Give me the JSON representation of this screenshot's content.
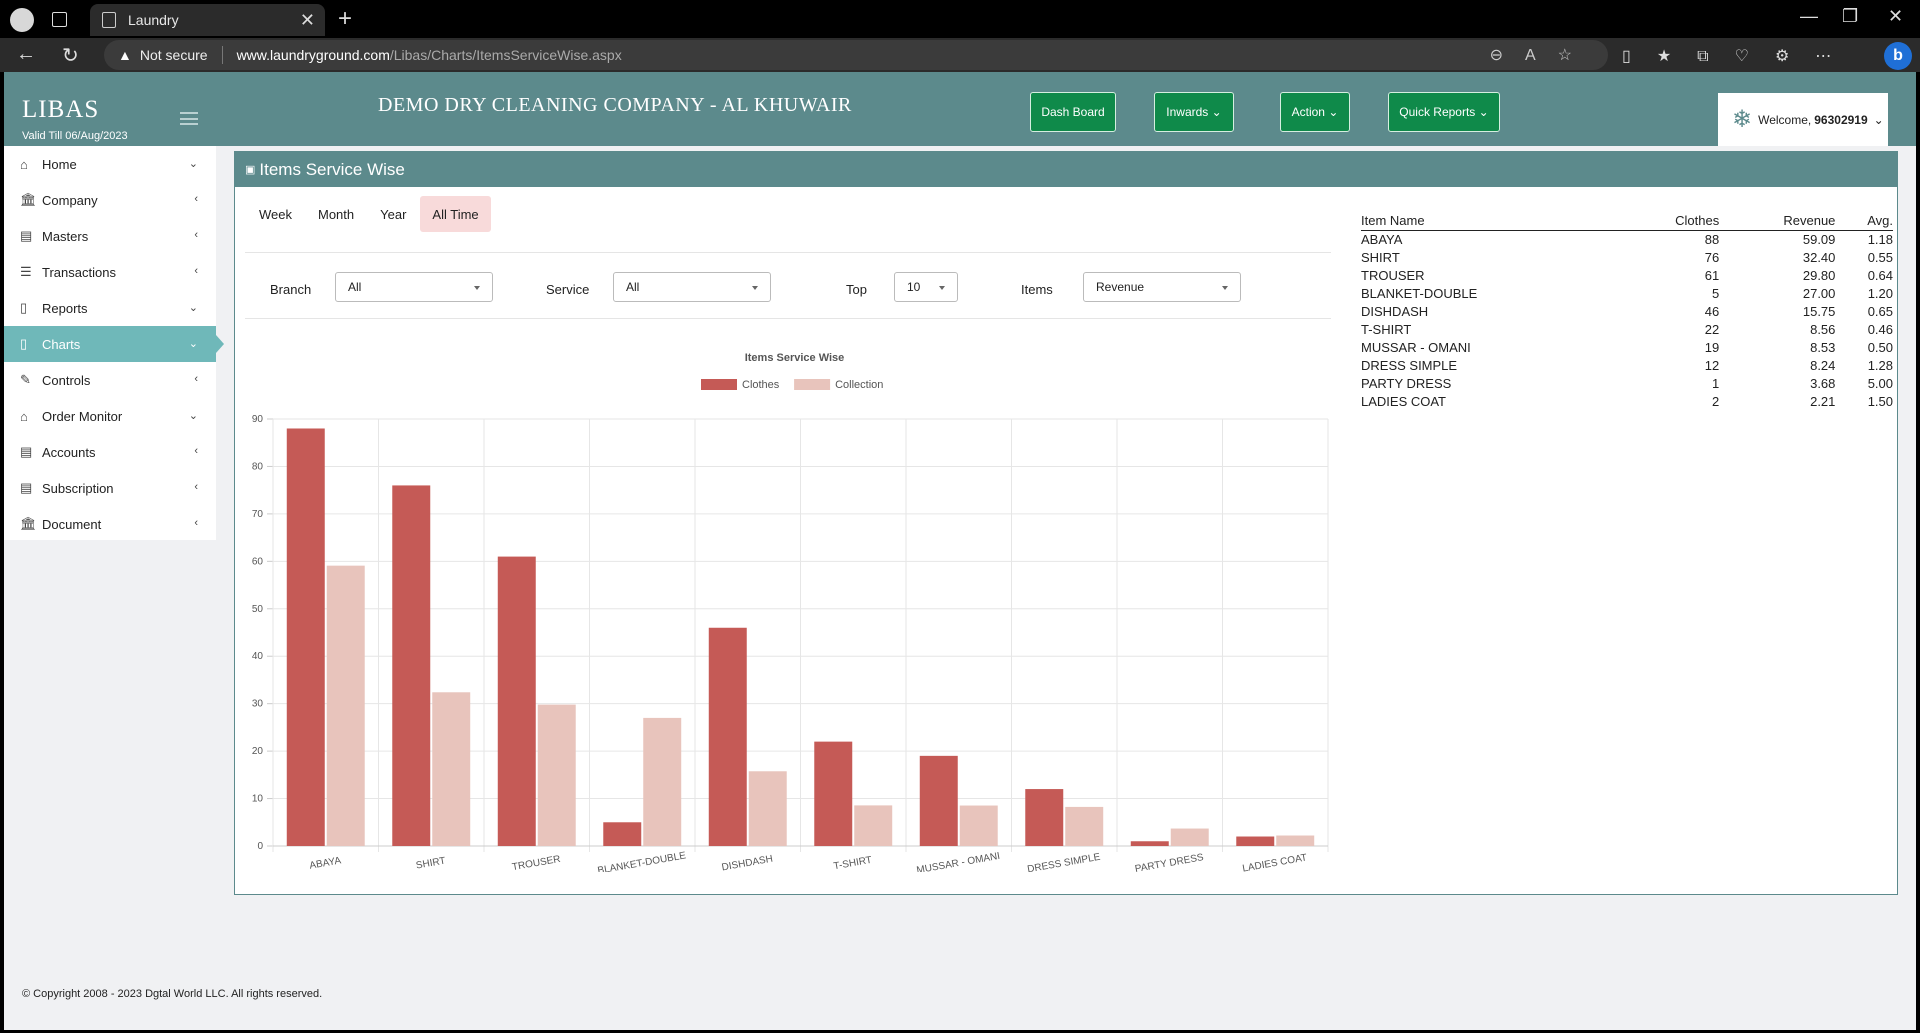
{
  "browser": {
    "tab_title": "Laundry",
    "not_secure": "Not secure",
    "url_host": "www.laundryground.com",
    "url_path": "/Libas/Charts/ItemsServiceWise.aspx"
  },
  "app": {
    "brand": "LIBAS",
    "valid_till": "Valid Till 06/Aug/2023",
    "company": "DEMO DRY CLEANING COMPANY - AL KHUWAIR",
    "buttons": {
      "dashboard": "Dash Board",
      "inwards": "Inwards",
      "action": "Action",
      "quick_reports": "Quick Reports"
    },
    "welcome_label": "Welcome,",
    "welcome_user": "96302919"
  },
  "sidebar": {
    "items": [
      {
        "label": "Home",
        "icon": "home-icon",
        "chevron": "down"
      },
      {
        "label": "Company",
        "icon": "bank-icon",
        "chevron": "left"
      },
      {
        "label": "Masters",
        "icon": "book-icon",
        "chevron": "left"
      },
      {
        "label": "Transactions",
        "icon": "list-icon",
        "chevron": "left"
      },
      {
        "label": "Reports",
        "icon": "file-icon",
        "chevron": "down"
      },
      {
        "label": "Charts",
        "icon": "file-icon",
        "chevron": "down",
        "active": true
      },
      {
        "label": "Controls",
        "icon": "wrench-icon",
        "chevron": "left"
      },
      {
        "label": "Order Monitor",
        "icon": "home-icon",
        "chevron": "down"
      },
      {
        "label": "Accounts",
        "icon": "book-icon",
        "chevron": "left"
      },
      {
        "label": "Subscription",
        "icon": "book-icon",
        "chevron": "left"
      },
      {
        "label": "Document",
        "icon": "bank-icon",
        "chevron": "left"
      }
    ]
  },
  "panel": {
    "title": "Items Service Wise",
    "period_tabs": [
      "Week",
      "Month",
      "Year",
      "All Time"
    ],
    "active_period": "All Time",
    "filters": {
      "branch_label": "Branch",
      "branch_value": "All",
      "service_label": "Service",
      "service_value": "All",
      "top_label": "Top",
      "top_value": "10",
      "items_label": "Items",
      "items_value": "Revenue"
    }
  },
  "chart_data": {
    "type": "bar",
    "title": "Items Service Wise",
    "categories": [
      "ABAYA",
      "SHIRT",
      "TROUSER",
      "BLANKET-DOUBLE",
      "DISHDASH",
      "T-SHIRT",
      "MUSSAR - OMANI",
      "DRESS SIMPLE",
      "PARTY DRESS",
      "LADIES COAT"
    ],
    "series": [
      {
        "name": "Clothes",
        "color": "#c55a56",
        "values": [
          88,
          76,
          61,
          5,
          46,
          22,
          19,
          12,
          1,
          2
        ]
      },
      {
        "name": "Collection",
        "color": "#e8c4bc",
        "values": [
          59.09,
          32.4,
          29.8,
          27.0,
          15.75,
          8.56,
          8.53,
          8.24,
          3.68,
          2.21
        ]
      }
    ],
    "ylim": [
      0,
      90
    ],
    "yticks": [
      0,
      10,
      20,
      30,
      40,
      50,
      60,
      70,
      80,
      90
    ],
    "grid": true,
    "legend_position": "top"
  },
  "summary_table": {
    "headers": [
      "Item Name",
      "Clothes",
      "Revenue",
      "Avg."
    ],
    "rows": [
      [
        "ABAYA",
        "88",
        "59.09",
        "1.18"
      ],
      [
        "SHIRT",
        "76",
        "32.40",
        "0.55"
      ],
      [
        "TROUSER",
        "61",
        "29.80",
        "0.64"
      ],
      [
        "BLANKET-DOUBLE",
        "5",
        "27.00",
        "1.20"
      ],
      [
        "DISHDASH",
        "46",
        "15.75",
        "0.65"
      ],
      [
        "T-SHIRT",
        "22",
        "8.56",
        "0.46"
      ],
      [
        "MUSSAR - OMANI",
        "19",
        "8.53",
        "0.50"
      ],
      [
        "DRESS SIMPLE",
        "12",
        "8.24",
        "1.28"
      ],
      [
        "PARTY DRESS",
        "1",
        "3.68",
        "5.00"
      ],
      [
        "LADIES COAT",
        "2",
        "2.21",
        "1.50"
      ]
    ]
  },
  "footer": "© Copyright 2008 - 2023 Dgtal World LLC. All rights reserved."
}
